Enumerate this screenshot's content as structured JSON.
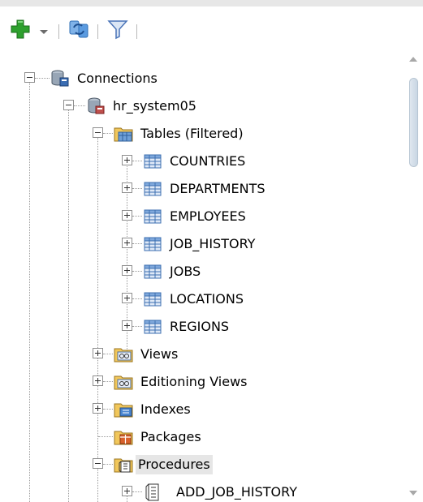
{
  "colors": {
    "accent_green": "#2ea02e",
    "refresh_blue": "#2f7bd1",
    "filter_blue": "#5a84c4",
    "grid_blue": "#3c6fb0",
    "folder_yellow": "#f1c75b",
    "selection_bg": "#e6e6e6"
  },
  "toolbar": {
    "add_icon": "add-connection-icon",
    "dropdown_icon": "chevron-down-icon",
    "refresh_icon": "refresh-icon",
    "filter_icon": "filter-icon"
  },
  "tree": {
    "root": {
      "label": "Connections",
      "icon": "connections-icon",
      "expanded": true
    },
    "connection": {
      "label": "hr_system05",
      "icon": "database-connection-icon",
      "expanded": true
    },
    "tables_folder": {
      "label": "Tables (Filtered)",
      "icon": "tables-folder-icon",
      "expanded": true
    },
    "tables": [
      {
        "label": "COUNTRIES",
        "icon": "table-icon"
      },
      {
        "label": "DEPARTMENTS",
        "icon": "table-icon"
      },
      {
        "label": "EMPLOYEES",
        "icon": "table-icon"
      },
      {
        "label": "JOB_HISTORY",
        "icon": "table-icon"
      },
      {
        "label": "JOBS",
        "icon": "table-icon"
      },
      {
        "label": "LOCATIONS",
        "icon": "table-icon"
      },
      {
        "label": "REGIONS",
        "icon": "table-icon"
      }
    ],
    "views": {
      "label": "Views",
      "icon": "views-folder-icon"
    },
    "editioning_views": {
      "label": "Editioning Views",
      "icon": "views-folder-icon"
    },
    "indexes": {
      "label": "Indexes",
      "icon": "indexes-folder-icon"
    },
    "packages": {
      "label": "Packages",
      "icon": "packages-folder-icon"
    },
    "procedures": {
      "label": "Procedures",
      "icon": "procedures-folder-icon",
      "selected": true
    },
    "procedure_items": [
      {
        "label": "ADD_JOB_HISTORY",
        "icon": "procedure-icon"
      }
    ]
  }
}
